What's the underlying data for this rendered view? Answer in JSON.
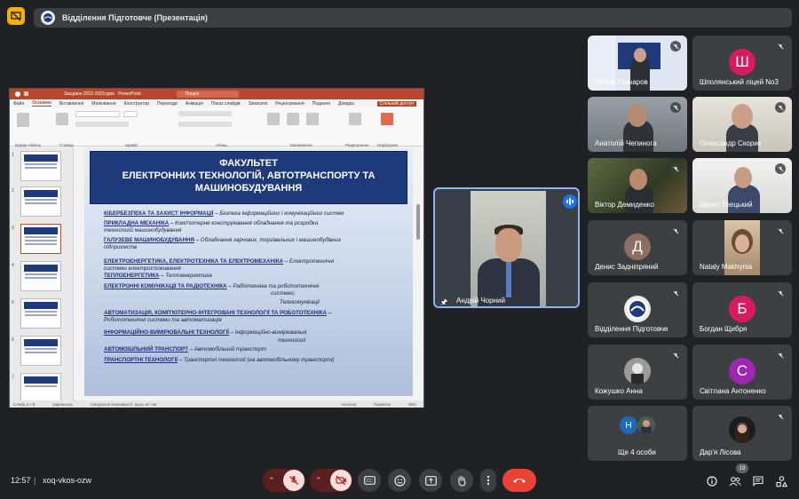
{
  "header": {
    "title": "Відділення Підготовче (Презентація)"
  },
  "ppt": {
    "window_title": "Засіданн 2022-2023.pptx · PowerPoint",
    "search": "Пошук",
    "tabs": [
      "Файл",
      "Основне",
      "Вставлення",
      "Малювання",
      "Конструктор",
      "Переходи",
      "Анімація",
      "Показ слайдів",
      "Записати",
      "Рецензування",
      "Подання",
      "Довідка"
    ],
    "active_tab": "Основне",
    "share": "Спільний доступ",
    "groups": [
      "Буфер обміну",
      "Слайди",
      "Шрифт",
      "Абзац",
      "Малювання",
      "Редагування",
      "Надбудови"
    ],
    "status_left": "Слайд 3 з 8",
    "status_lang": "українська",
    "status_access": "Спеціальні можливості: щось не так",
    "status_notes": "Нотатки",
    "status_comments": "Примітки",
    "zoom": "89%"
  },
  "slide": {
    "title_line1": "ФАКУЛЬТЕТ",
    "title_line2": "ЕЛЕКТРОННИХ ТЕХНОЛОГІЙ, АВТОТРАНСПОРТУ ТА",
    "title_line3": "МАШИНОБУДУВАННЯ",
    "l1a": "КІБЕРБЕЗПЕКА ТА ЗАХИСТ ІНФОРМАЦІЇ",
    "l1b": " – Безпека інформаційних і комунікаційних систем",
    "l2a": "ПРИКЛАДНА МЕХАНІКА",
    "l2b": " – Комп'ютерне конструювання обладнання та розробка",
    "l2c": "технологій машинобудування",
    "l3a": "ГАЛУЗЕВЕ МАШИНОБУДУВАННЯ",
    "l3b": " – Обладнання харчових, торгівельних і машинобудівних",
    "l3c": "підприємств",
    "l4a": "ЕЛЕКТРОЕНЕРГЕТИКА, ЕЛЕКТРОТЕХНІКА ТА ЕЛЕКТРОМЕХАНІКА",
    "l4b": " – Електротехнічні",
    "l4c": "системи електроспоживання",
    "l5a": "ТЕПЛОЕНЕРГЕТИКА",
    "l5b": " – Теплоенергетика",
    "l6a": "ЕЛЕКТРОННІ КОМУНІКАЦІЇ ТА РАДІОТЕХНІКА",
    "l6b": " – Радіотехніка та робототехнічні",
    "l6c": "системи;",
    "l6d": "Телекомунікації",
    "l7a": "АВТОМАТИЗАЦІЯ, КОМП'ЮТЕРНО-ІНТЕГРОВАНІ ТЕХНОЛОГІЇ ТА РОБОТОТЕХНІКА",
    "l7b": " –",
    "l7c": "Робототехнічні системи та автоматизація",
    "l8a": "ІНФОРМАЦІЙНО-ВИМІРЮВАЛЬНІ ТЕХНОЛОГІЇ",
    "l8b": " – Інформаційно-вимірювальні",
    "l8c": "технології",
    "l9a": "АВТОМОБІЛЬНИЙ ТРАНСПОРТ",
    "l9b": " – Автомобільний транспорт",
    "l10a": "ТРАНСПОРТНІ ТЕХНОЛОГІЇ",
    "l10b": " – Транспортні технології (на автомобільному транспорті)"
  },
  "thumb_numbers": [
    "1",
    "2",
    "3",
    "4",
    "5",
    "6",
    "7"
  ],
  "speaker": {
    "name": "Андрій Чорний"
  },
  "participants": [
    {
      "name": "Артем Гончаров"
    },
    {
      "name": "Шполянський ліцей No3",
      "initial": "Ш",
      "color": "#d81b60"
    },
    {
      "name": "Анатолій Чепинога"
    },
    {
      "name": "Олександр Скорик"
    },
    {
      "name": "Віктор Демиденко"
    },
    {
      "name": "Денис Трецький"
    },
    {
      "name": "Денис Задніпряний",
      "initial": "Д",
      "color": "#8d6e63"
    },
    {
      "name": "Nataly Makhynia"
    },
    {
      "name": "Відділення Підготовче"
    },
    {
      "name": "Богдан Щибря",
      "initial": "Б",
      "color": "#d81b60"
    },
    {
      "name": "Кожушко Анна"
    },
    {
      "name": "Світлана Антоненко",
      "initial": "С",
      "color": "#9c27b0"
    },
    {
      "name": "Ще 4 особи",
      "initial": "Н",
      "color": "#1e6ab8"
    },
    {
      "name": "Дар'я Лісова"
    }
  ],
  "footer": {
    "time": "12:57",
    "meeting_code": "xoq-vkos-ozw",
    "people_count": "19"
  },
  "colors": {
    "bg": "#202124",
    "tile": "#3c4043",
    "accent": "#8ab4f8",
    "end_call": "#ea4335"
  }
}
